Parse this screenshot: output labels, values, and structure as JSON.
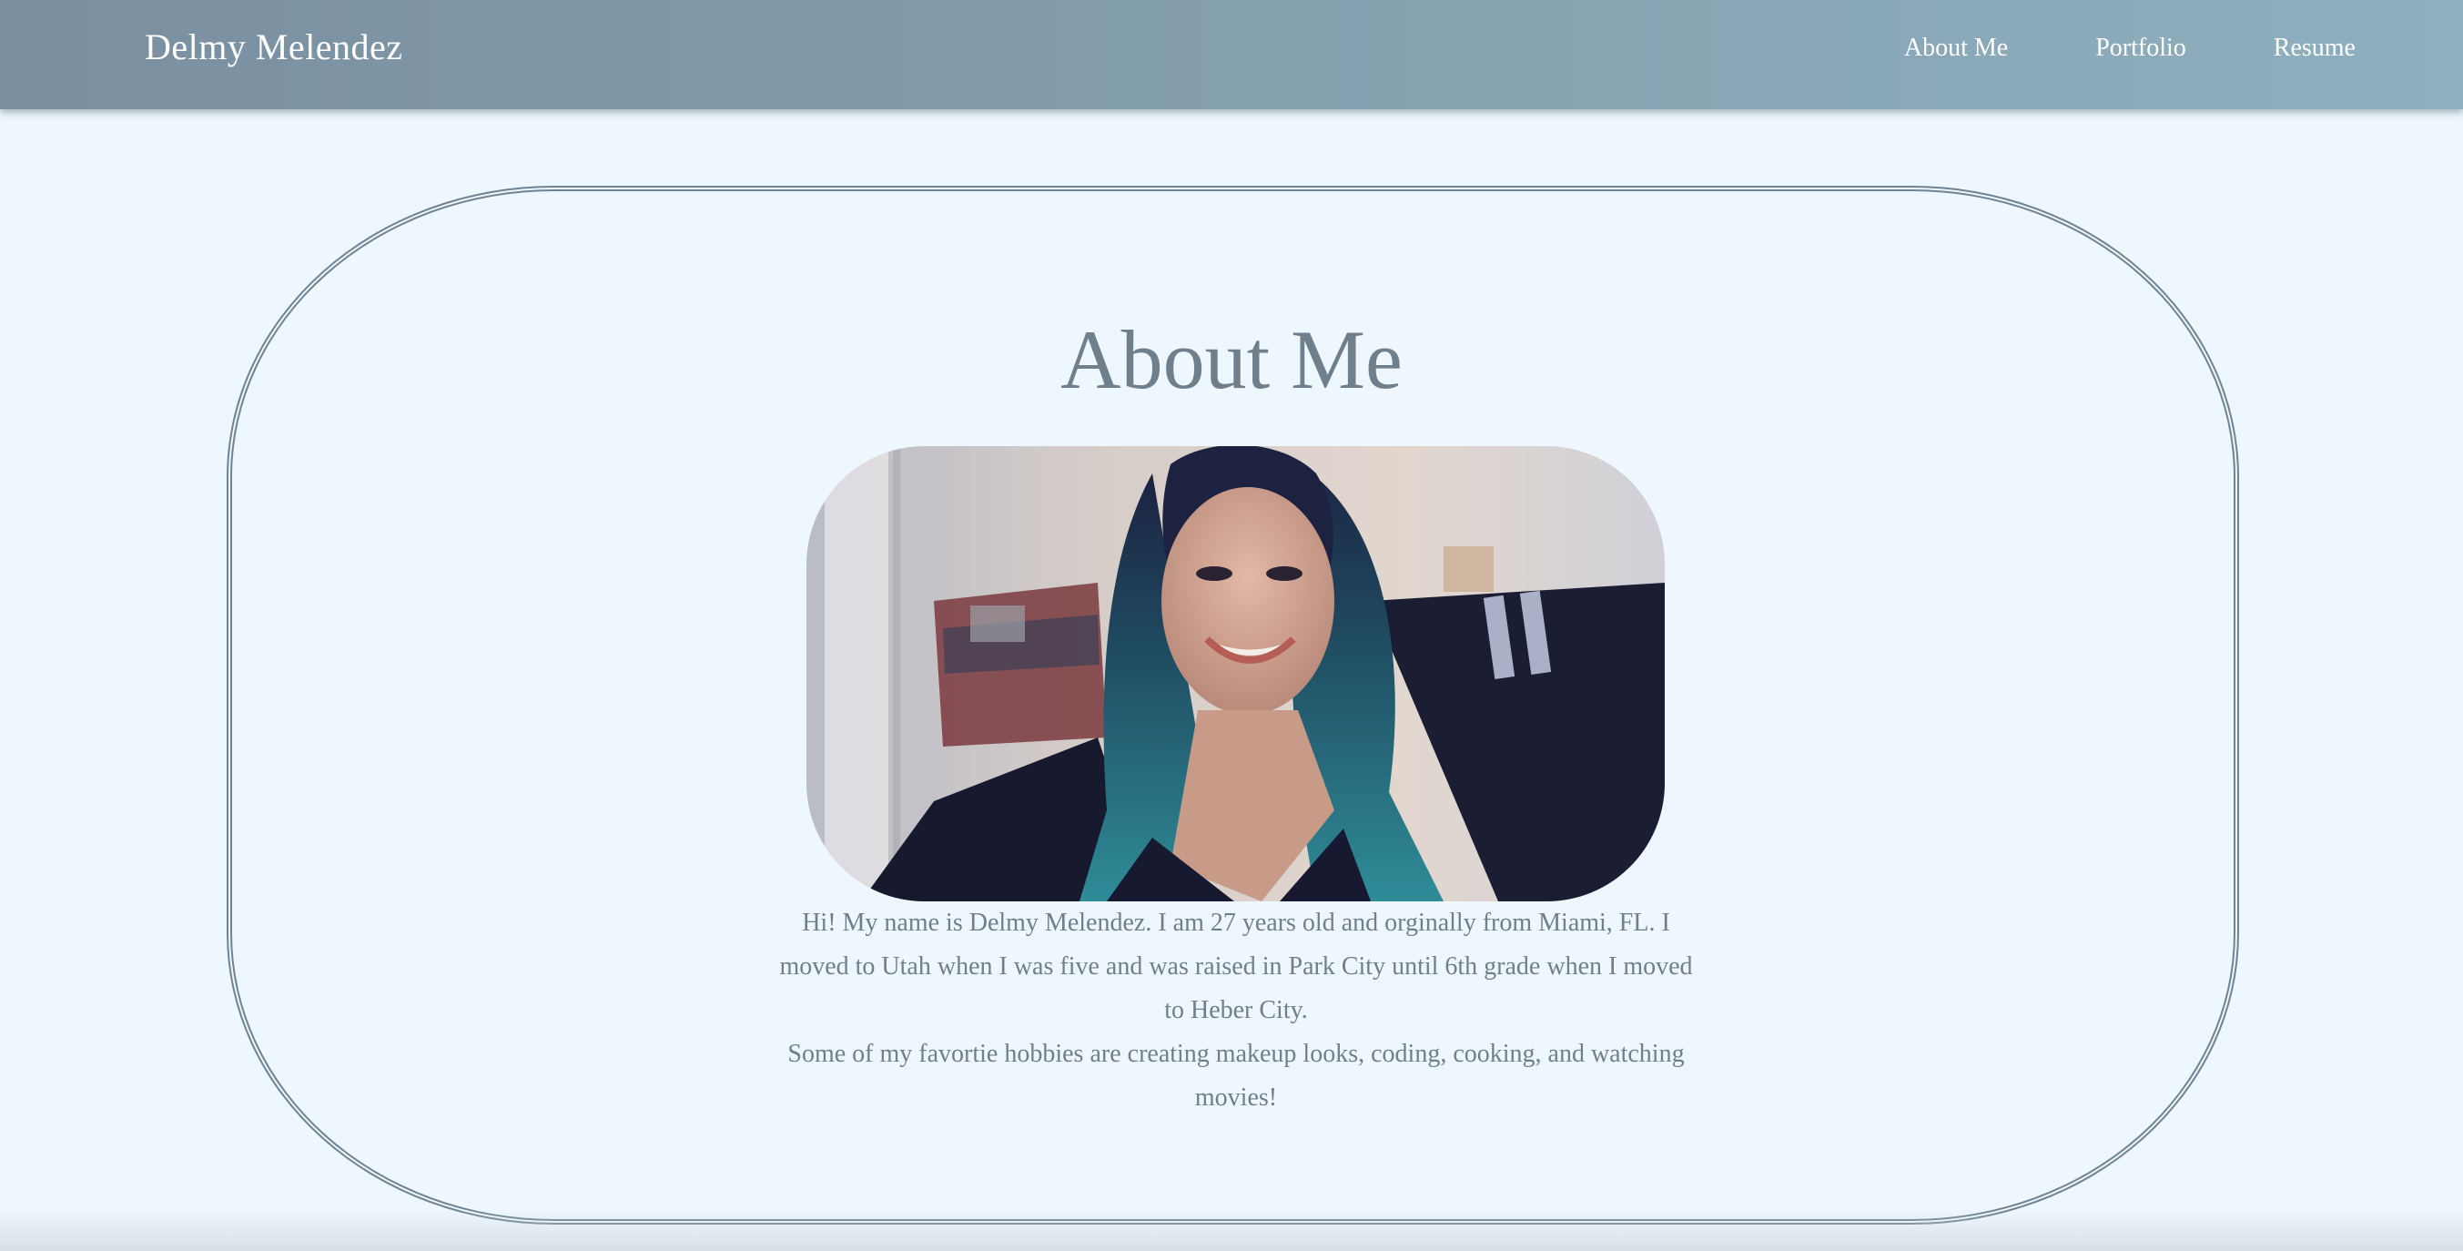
{
  "header": {
    "brand": "Delmy Melendez",
    "nav": [
      {
        "label": "About Me"
      },
      {
        "label": "Portfolio"
      },
      {
        "label": "Resume"
      }
    ]
  },
  "main": {
    "heading": "About Me",
    "photo_alt": "Selfie of Delmy Melendez with long teal hair",
    "bio_paragraphs": [
      "Hi! My name is Delmy Melendez. I am 27 years old and orginally from Miami, FL. I moved to Utah when I was five and was raised in Park City until 6th grade when I moved to Heber City.",
      "Some of my favortie hobbies are creating makeup looks, coding, cooking, and watching movies!"
    ]
  },
  "colors": {
    "background": "#eef7fd",
    "navbar_start": "#7a8fa0",
    "navbar_end": "#8eb0c0",
    "text": "#6f7f8c",
    "border": "#6f8392"
  }
}
